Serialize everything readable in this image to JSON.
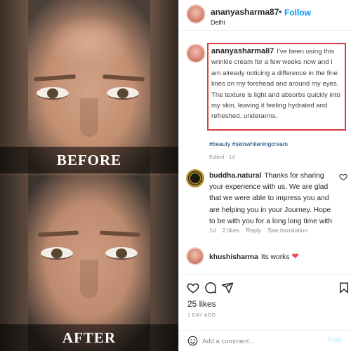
{
  "photo": {
    "before_label": "BEFORE",
    "after_label": "AFTER"
  },
  "header": {
    "username": "ananyasharma87",
    "separator": "•",
    "follow_label": "Follow",
    "location": "Delhi"
  },
  "caption": {
    "username": "ananyasharma87",
    "text": "I've been using this wrinkle cream for a few weeks now and I am already noticing a difference in the fine lines on my forehead and around my eyes. The texture is light and absorbs quickly into my skin, leaving it feeling hydrated and refreshed. underarms.",
    "hashtags": "#beauty #skinwhiteningcream",
    "edited": "Edited · 1d"
  },
  "comments": [
    {
      "username": "buddha.natural",
      "text": "Thanks for sharing your experience with us. We are glad that we were able to impress you and are helping you in your Journey. Hope to be with you for a long long time with",
      "age": "1d",
      "likes": "2 likes",
      "reply_label": "Reply",
      "translation_label": "See translation"
    },
    {
      "username": "khushisharma",
      "text": "Its works",
      "emoji": "❤"
    }
  ],
  "actions": {
    "icons": [
      "heart-icon",
      "comment-icon",
      "share-icon",
      "bookmark-icon"
    ],
    "likes": "25 likes",
    "time": "1 DAY AGO"
  },
  "add_comment": {
    "placeholder": "Add a comment...",
    "post_label": "Post"
  },
  "colors": {
    "accent": "#0095f6",
    "caption_border": "#d9393f",
    "heart": "#ed4956"
  }
}
